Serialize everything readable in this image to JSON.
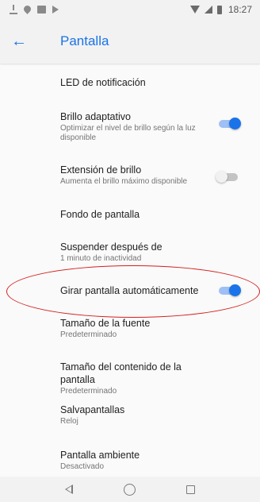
{
  "status_bar": {
    "time": "18:27",
    "left_icons": [
      "download-icon",
      "location-icon",
      "image-icon",
      "play-store-icon"
    ],
    "right_icons": [
      "wifi-icon",
      "signal-icon",
      "battery-icon"
    ]
  },
  "toolbar": {
    "back_icon": "arrow-left-icon",
    "back_glyph": "←",
    "title": "Pantalla"
  },
  "settings": [
    {
      "id": "led",
      "title": "LED de notificación",
      "subtitle": ""
    },
    {
      "id": "brillo-adaptativo",
      "title": "Brillo adaptativo",
      "subtitle": "Optimizar el nivel de brillo según la luz disponible",
      "toggle": true
    },
    {
      "id": "extension-brillo",
      "title": "Extensión de brillo",
      "subtitle": "Aumenta el brillo máximo disponible",
      "toggle": false
    },
    {
      "id": "fondo",
      "title": "Fondo de pantalla",
      "subtitle": ""
    },
    {
      "id": "suspender",
      "title": "Suspender después de",
      "subtitle": "1 minuto de inactividad"
    },
    {
      "id": "girar",
      "title": "Girar pantalla automáticamente",
      "subtitle": "",
      "toggle": true
    },
    {
      "id": "fuente",
      "title": "Tamaño de la fuente",
      "subtitle": "Predeterminado"
    },
    {
      "id": "contenido",
      "title": "Tamaño del contenido de la pantalla",
      "subtitle": "Predeterminado"
    },
    {
      "id": "salvapantallas",
      "title": "Salvapantallas",
      "subtitle": "Reloj"
    },
    {
      "id": "ambiente",
      "title": "Pantalla ambiente",
      "subtitle": "Desactivado"
    }
  ],
  "colors": {
    "accent": "#1a73e8",
    "annotation": "#d41f1f",
    "bar_background": "#f2f2f2"
  },
  "nav_bar": {
    "icons": [
      "nav-back-icon",
      "nav-home-icon",
      "nav-recents-icon"
    ]
  }
}
